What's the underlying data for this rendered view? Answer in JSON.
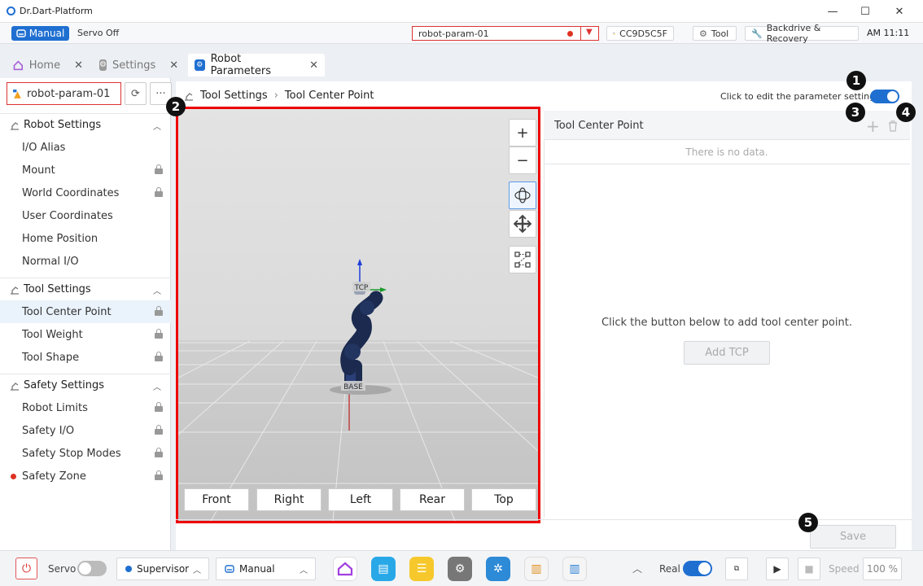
{
  "window": {
    "title": "Dr.Dart-Platform",
    "minimize": "—",
    "maximize": "☐",
    "close": "✕"
  },
  "status": {
    "mode": "Manual",
    "servo": "Servo Off",
    "param_name": "robot-param-01",
    "controller_id": "CC9D5C5F",
    "tool_label": "Tool",
    "backdrive_label": "Backdrive & Recovery",
    "time": "AM 11:11"
  },
  "tabs": [
    {
      "label": "Home"
    },
    {
      "label": "Settings"
    },
    {
      "label": "Robot Parameters"
    }
  ],
  "sidebar": {
    "param_select": "robot-param-01",
    "groups": [
      {
        "title": "Robot Settings",
        "items": [
          "I/O Alias",
          "Mount",
          "World Coordinates",
          "User Coordinates",
          "Home Position",
          "Normal I/O"
        ]
      },
      {
        "title": "Tool Settings",
        "items": [
          "Tool Center Point",
          "Tool Weight",
          "Tool Shape"
        ]
      },
      {
        "title": "Safety Settings",
        "items": [
          "Robot Limits",
          "Safety I/O",
          "Safety Stop Modes",
          "Safety Zone"
        ]
      }
    ],
    "active_item": "Tool Center Point"
  },
  "breadcrumb": {
    "parent": "Tool Settings",
    "current": "Tool Center Point"
  },
  "edit_hint": "Click to edit the parameter settings.",
  "viewport": {
    "zoom_in": "+",
    "zoom_out": "−",
    "tcp_label": "TCP",
    "base_label": "BASE",
    "views": [
      "Front",
      "Right",
      "Left",
      "Rear",
      "Top"
    ]
  },
  "tcp_panel": {
    "title": "Tool Center Point",
    "no_data": "There is no data.",
    "empty_message": "Click the button below to add tool center point.",
    "add_button": "Add TCP"
  },
  "save_button": "Save",
  "badges": [
    "1",
    "2",
    "3",
    "4",
    "5"
  ],
  "bottom": {
    "servo_label": "Servo",
    "role": "Supervisor",
    "mode": "Manual",
    "real_label": "Real",
    "speed_label": "Speed",
    "speed_value": "100 %"
  },
  "colors": {
    "accent": "#1f6fd1",
    "warning_red": "#dd0000"
  }
}
